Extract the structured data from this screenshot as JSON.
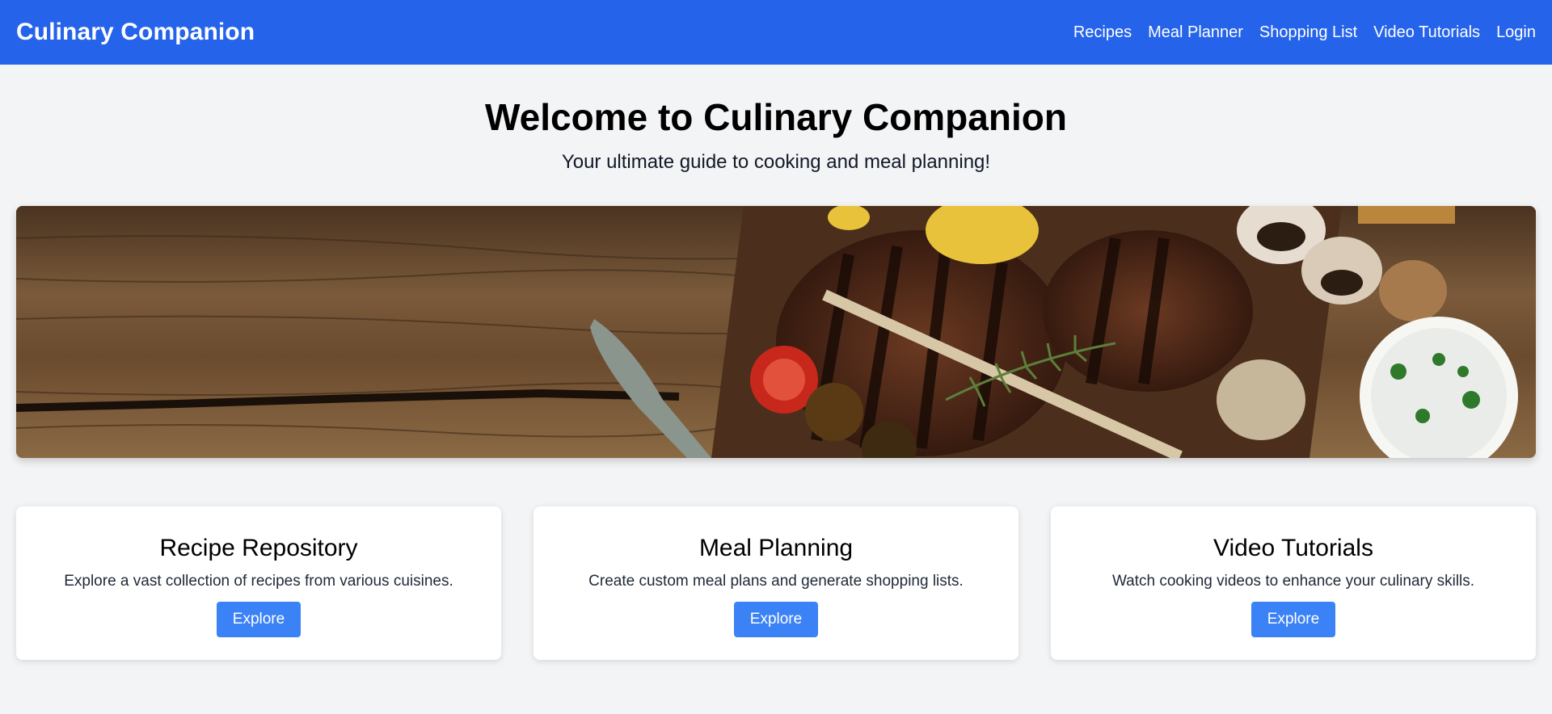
{
  "nav": {
    "brand": "Culinary Companion",
    "links": [
      "Recipes",
      "Meal Planner",
      "Shopping List",
      "Video Tutorials",
      "Login"
    ]
  },
  "hero": {
    "title": "Welcome to Culinary Companion",
    "subtitle": "Your ultimate guide to cooking and meal planning!"
  },
  "banner": {
    "image": "grilled-steak-on-wooden-table"
  },
  "cards": [
    {
      "title": "Recipe Repository",
      "description": "Explore a vast collection of recipes from various cuisines.",
      "button": "Explore"
    },
    {
      "title": "Meal Planning",
      "description": "Create custom meal plans and generate shopping lists.",
      "button": "Explore"
    },
    {
      "title": "Video Tutorials",
      "description": "Watch cooking videos to enhance your culinary skills.",
      "button": "Explore"
    }
  ],
  "colors": {
    "navbar": "#2563eb",
    "button": "#3b82f6",
    "background": "#f3f4f6"
  }
}
